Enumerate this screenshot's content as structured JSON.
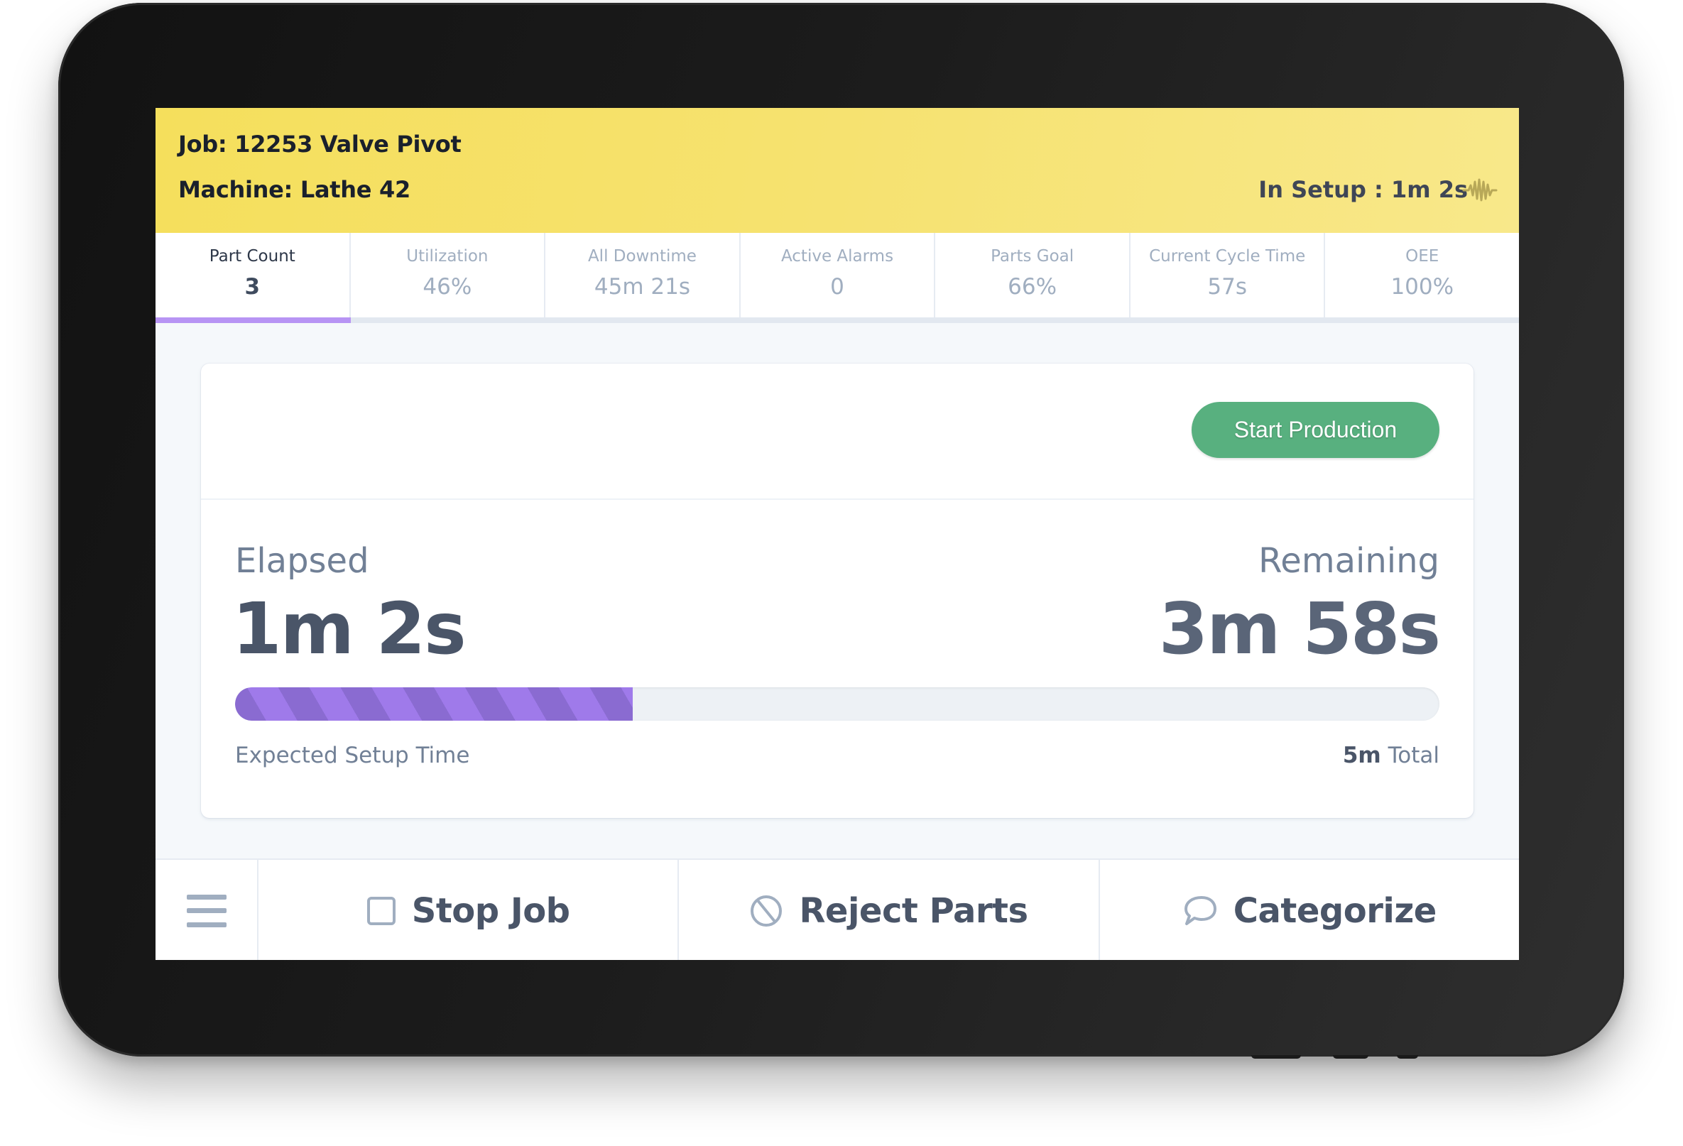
{
  "header": {
    "job": "Job: 12253 Valve Pivot",
    "machine": "Machine: Lathe 42",
    "status": "In Setup : 1m 2s",
    "status_icon": "waveform-icon",
    "background_color": "#f6e270"
  },
  "stats": [
    {
      "label": "Part Count",
      "value": "3",
      "active": true
    },
    {
      "label": "Utilization",
      "value": "46%",
      "active": false
    },
    {
      "label": "All Downtime",
      "value": "45m 21s",
      "active": false
    },
    {
      "label": "Active Alarms",
      "value": "0",
      "active": false
    },
    {
      "label": "Parts Goal",
      "value": "66%",
      "active": false
    },
    {
      "label": "Current Cycle Time",
      "value": "57s",
      "active": false
    },
    {
      "label": "OEE",
      "value": "100%",
      "active": false
    }
  ],
  "setup": {
    "start_button": "Start Production",
    "start_button_color": "#58b07f",
    "elapsed_label": "Elapsed",
    "elapsed_value": "1m 2s",
    "remaining_label": "Remaining",
    "remaining_value": "3m 58s",
    "progress_fraction": 0.33,
    "progress_color": "#9f7aea",
    "expected_label": "Expected Setup Time",
    "total_value": "5m",
    "total_label": "Total"
  },
  "bottom_bar": {
    "menu_icon": "hamburger-menu-icon",
    "buttons": [
      {
        "label": "Stop Job",
        "icon": "square-stop-icon"
      },
      {
        "label": "Reject Parts",
        "icon": "prohibited-icon"
      },
      {
        "label": "Categorize",
        "icon": "speech-bubble-icon"
      }
    ]
  }
}
